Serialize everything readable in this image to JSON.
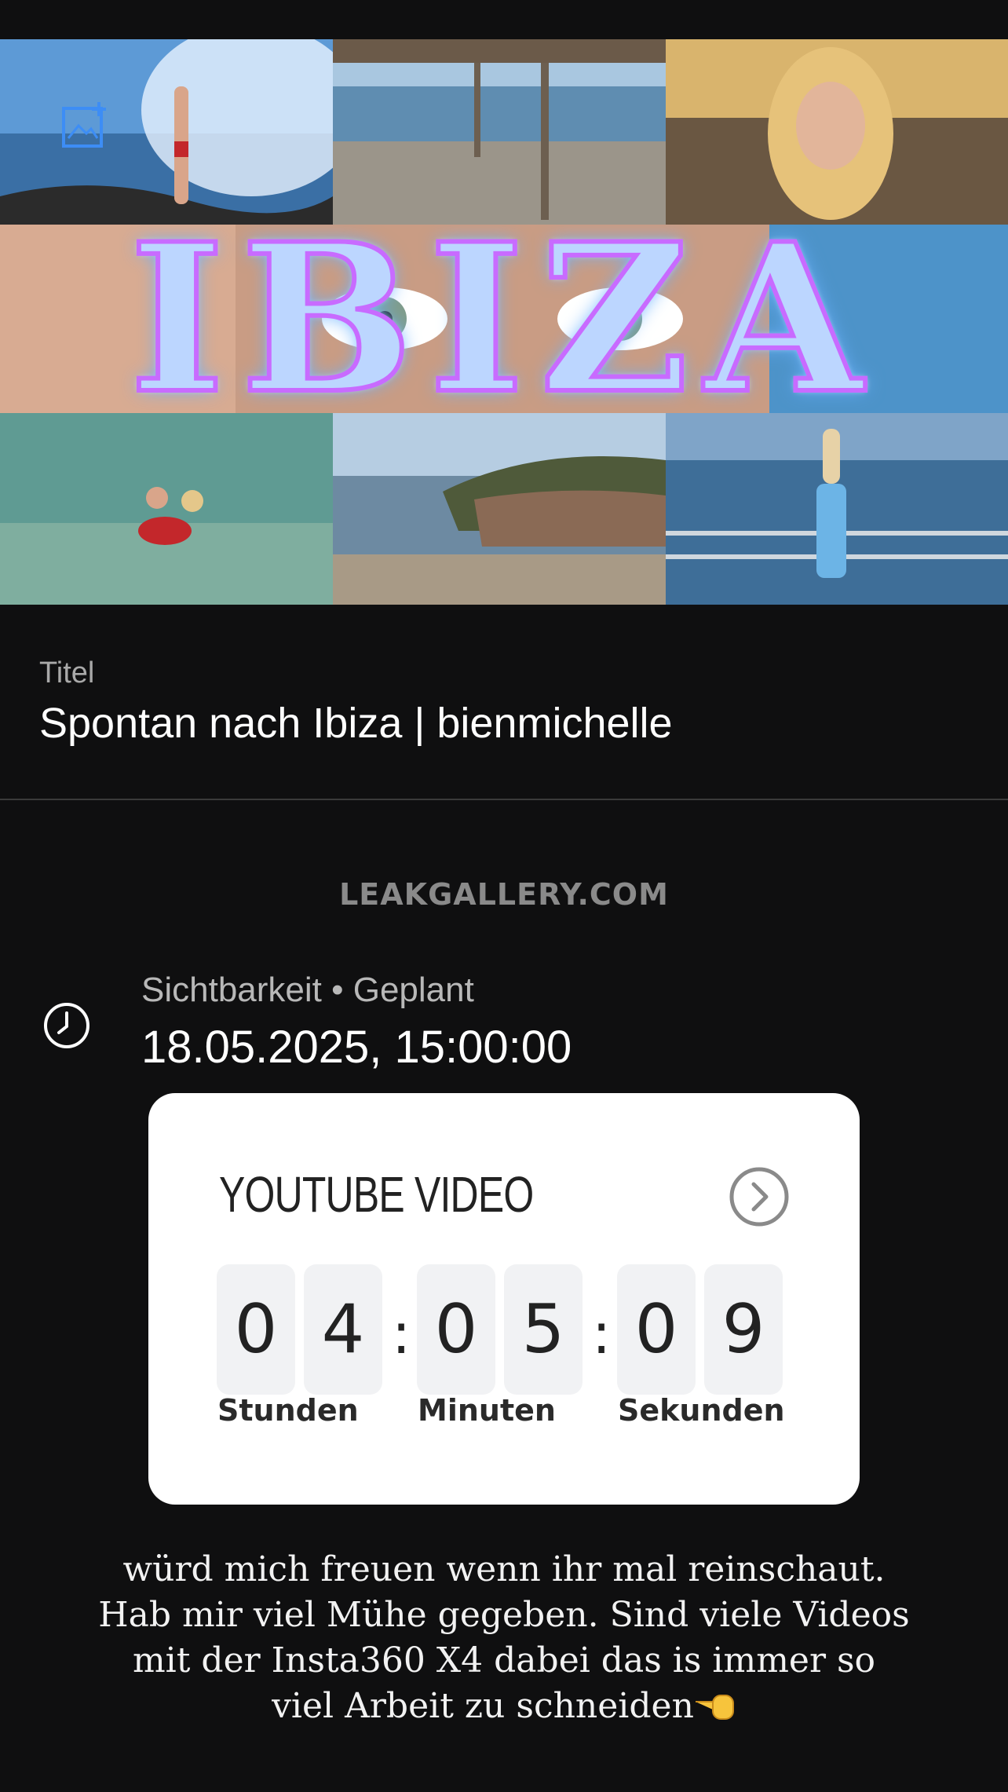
{
  "thumbnail": {
    "overlay_text": "IBIZA",
    "add_icon": "add-image-icon"
  },
  "title": {
    "label": "Titel",
    "value": "Spontan nach Ibiza | bienmichelle"
  },
  "watermark": "LEAKGALLERY.COM",
  "visibility": {
    "icon": "clock-icon",
    "label": "Sichtbarkeit • Geplant",
    "date": "18.05.2025, 15:00:00"
  },
  "countdown": {
    "title": "YOUTUBE VIDEO",
    "arrow_icon": "chevron-right-circle-icon",
    "hours": [
      "0",
      "4"
    ],
    "minutes": [
      "0",
      "5"
    ],
    "seconds": [
      "0",
      "9"
    ],
    "separator": ":",
    "labels": {
      "hours": "Stunden",
      "minutes": "Minuten",
      "seconds": "Sekunden"
    }
  },
  "caption": {
    "lines": [
      "würd mich freuen wenn ihr mal reinschaut.",
      "Hab mir viel Mühe gegeben. Sind viele Videos",
      "mit der Insta360 X4 dabei das is immer so",
      "viel Arbeit zu schneiden"
    ],
    "emoji": "pointing-hand-emoji"
  },
  "colors": {
    "background": "#0f0f10",
    "card": "#ffffff",
    "accent_blue": "#4aa3ff"
  }
}
